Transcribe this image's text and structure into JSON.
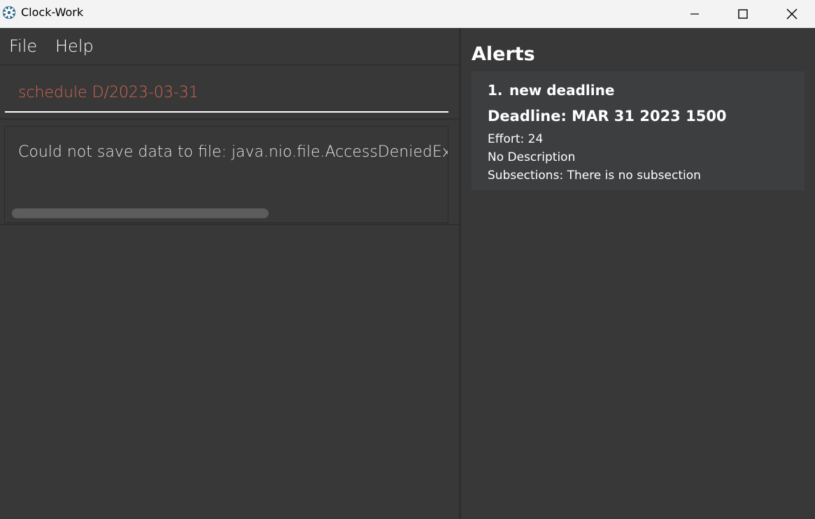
{
  "window": {
    "title": "Clock-Work",
    "icon": "gear-icon"
  },
  "menu": {
    "items": [
      "File",
      "Help"
    ]
  },
  "command": {
    "value": "schedule D/2023-03-31",
    "color": "#d06651"
  },
  "result": {
    "text": "Could not save data to file: java.nio.file.AccessDeniedException"
  },
  "alerts": {
    "title": "Alerts",
    "items": [
      {
        "index": "1.",
        "name": "new deadline",
        "deadline": "Deadline: MAR 31 2023 1500",
        "effort": "Effort: 24",
        "description": "No Description",
        "subsections": "Subsections: There is no subsection"
      }
    ]
  },
  "colors": {
    "background": "#383838",
    "card": "#3c3e3f",
    "titlebar": "#f3f3f3"
  }
}
